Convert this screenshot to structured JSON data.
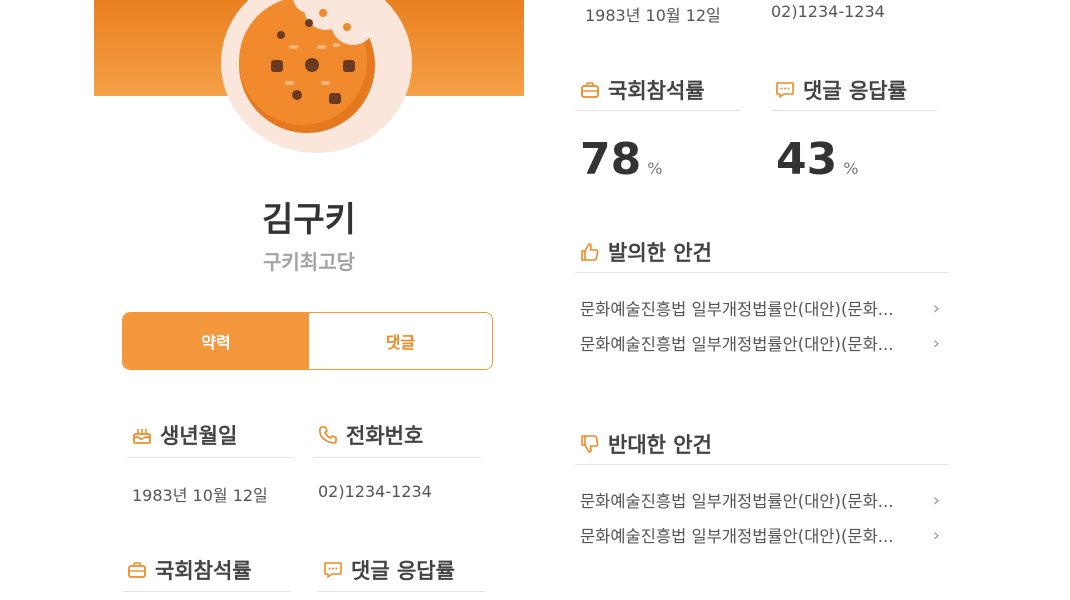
{
  "profile": {
    "name": "김구키",
    "group": "구키최고당"
  },
  "tabs": {
    "active": "약력",
    "second": "댓글"
  },
  "left": {
    "birth_label": "생년월일",
    "birth_value": "1983년 10월 12일",
    "phone_label": "전화번호",
    "phone_value": "02)1234-1234",
    "attendance_label": "국회참석률",
    "reply_label": "댓글 응답률"
  },
  "right": {
    "birth_value": "1983년 10월 12일",
    "phone_value": "02)1234-1234",
    "attendance_label": "국회참석률",
    "attendance_value": "78",
    "attendance_unit": "%",
    "reply_label": "댓글 응답률",
    "reply_value": "43",
    "reply_unit": "%",
    "proposed_title": "발의한 안건",
    "proposed_items": [
      "문화예술진흥법 일부개정법률안(대안)(문화...",
      "문화예술진흥법 일부개정법률안(대안)(문화..."
    ],
    "opposed_title": "반대한 안건",
    "opposed_items": [
      "문화예술진흥법 일부개정법률안(대안)(문화...",
      "문화예술진흥법 일부개정법률안(대안)(문화..."
    ]
  },
  "colors": {
    "accent": "#f4973d",
    "accent_dark": "#e8801f",
    "avatar_bg": "#fbe6dc",
    "cookie": "#f08a2c"
  },
  "icons": {
    "birth": "cake-icon",
    "phone": "phone-icon",
    "attendance": "briefcase-icon",
    "reply": "chat-bubble-icon",
    "proposed": "thumbs-up-icon",
    "opposed": "thumbs-down-icon",
    "chevron": "chevron-right-icon"
  }
}
